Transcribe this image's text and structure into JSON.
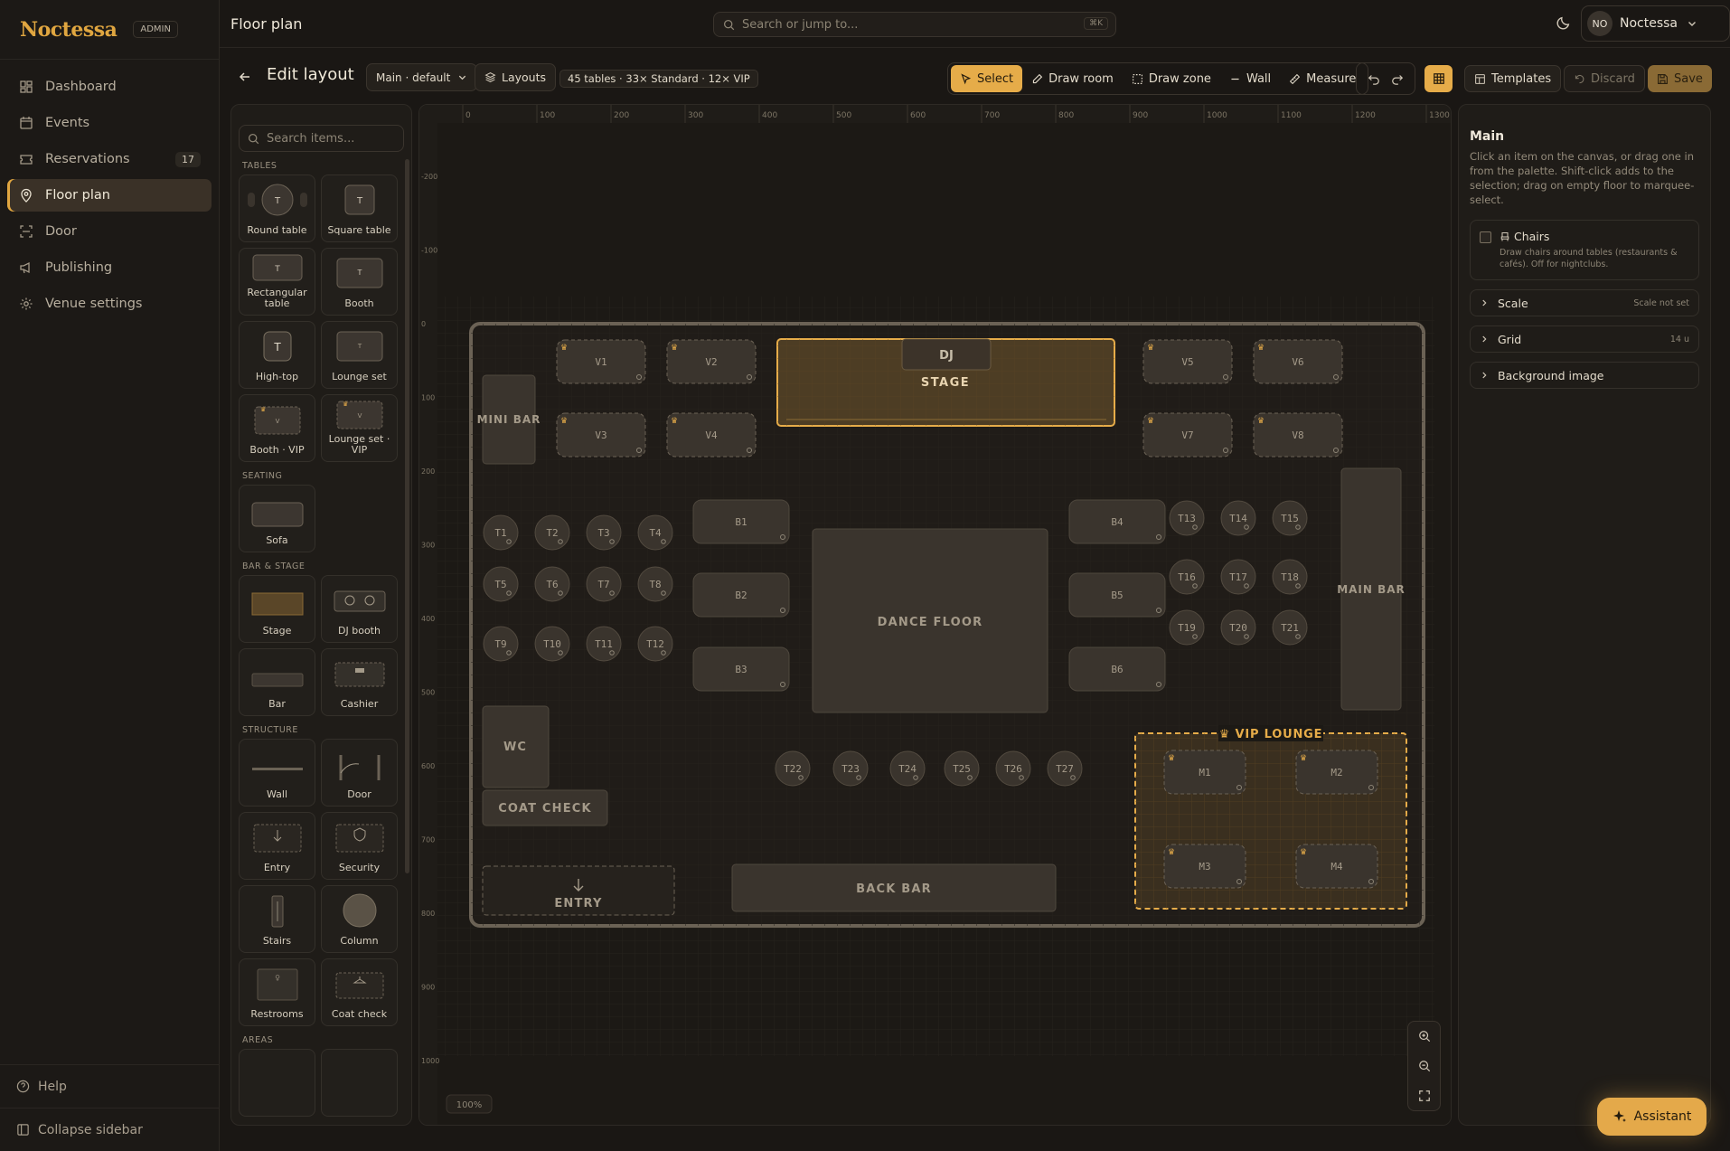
{
  "brand": {
    "name": "Noctessa",
    "badge": "ADMIN"
  },
  "nav": [
    {
      "label": "Dashboard",
      "icon": "dashboard-icon"
    },
    {
      "label": "Events",
      "icon": "calendar-icon"
    },
    {
      "label": "Reservations",
      "icon": "ticket-icon",
      "count": "17"
    },
    {
      "label": "Floor plan",
      "icon": "map-pin-icon",
      "active": true
    },
    {
      "label": "Door",
      "icon": "scan-icon"
    },
    {
      "label": "Publishing",
      "icon": "megaphone-icon"
    },
    {
      "label": "Venue settings",
      "icon": "gear-icon"
    }
  ],
  "footer": {
    "help": "Help",
    "collapse": "Collapse sidebar"
  },
  "topbar": {
    "title": "Floor plan",
    "search_placeholder": "Search or jump to...",
    "search_kbd": "⌘K",
    "user_initials": "NO",
    "user_name": "Noctessa"
  },
  "toolbar": {
    "heading": "Edit layout",
    "layout_select": "Main · default",
    "layouts_btn": "Layouts",
    "stats": "45 tables · 33× Standard · 12× VIP",
    "tools": [
      "Select",
      "Draw room",
      "Draw zone",
      "Wall",
      "Measure"
    ],
    "templates": "Templates",
    "discard": "Discard",
    "save": "Save"
  },
  "palette": {
    "search_placeholder": "Search items...",
    "sections": [
      {
        "label": "TABLES",
        "items": [
          "Round table",
          "Square table",
          "Rectangular table",
          "Booth",
          "High-top",
          "Lounge set",
          "Booth · VIP",
          "Lounge set · VIP"
        ]
      },
      {
        "label": "SEATING",
        "items": [
          "Sofa"
        ]
      },
      {
        "label": "BAR & STAGE",
        "items": [
          "Stage",
          "DJ booth",
          "Bar",
          "Cashier"
        ]
      },
      {
        "label": "STRUCTURE",
        "items": [
          "Wall",
          "Door",
          "Entry",
          "Security",
          "Stairs",
          "Column",
          "Restrooms",
          "Coat check"
        ]
      },
      {
        "label": "AREAS",
        "items": []
      }
    ]
  },
  "canvas": {
    "zoom": "100%",
    "ruler_x": [
      "0",
      "100",
      "200",
      "300",
      "400",
      "500",
      "600",
      "700",
      "800",
      "900",
      "1000",
      "1100",
      "1200",
      "1300"
    ],
    "ruler_y": [
      "-200",
      "-100",
      "0",
      "100",
      "200",
      "300",
      "400",
      "500",
      "600",
      "700",
      "800",
      "900",
      "1000"
    ],
    "zones": {
      "stage": "STAGE",
      "dj": "DJ",
      "mini_bar": "MINI BAR",
      "main_bar": "MAIN BAR",
      "dance_floor": "DANCE FLOOR",
      "wc": "WC",
      "coat_check": "COAT CHECK",
      "entry": "ENTRY",
      "back_bar": "BACK BAR",
      "vip_lounge": "VIP LOUNGE"
    },
    "vip_tables": [
      "V1",
      "V2",
      "V3",
      "V4",
      "V5",
      "V6",
      "V7",
      "V8"
    ],
    "booths": [
      "B1",
      "B2",
      "B3",
      "B4",
      "B5",
      "B6"
    ],
    "round_tables": [
      "T1",
      "T2",
      "T3",
      "T4",
      "T5",
      "T6",
      "T7",
      "T8",
      "T9",
      "T10",
      "T11",
      "T12",
      "T13",
      "T14",
      "T15",
      "T16",
      "T17",
      "T18",
      "T19",
      "T20",
      "T21",
      "T22",
      "T23",
      "T24",
      "T25",
      "T26",
      "T27"
    ],
    "lounge_tables": [
      "M1",
      "M2",
      "M3",
      "M4"
    ]
  },
  "inspector": {
    "title": "Main",
    "description": "Click an item on the canvas, or drag one in from the palette. Shift-click adds to the selection; drag on empty floor to marquee-select.",
    "chairs_label": "Chairs",
    "chairs_desc": "Draw chairs around tables (restaurants & cafés). Off for nightclubs.",
    "rows": [
      {
        "label": "Scale",
        "value": "Scale not set"
      },
      {
        "label": "Grid",
        "value": "14 u"
      },
      {
        "label": "Background image",
        "value": ""
      }
    ]
  },
  "assistant": "Assistant",
  "colors": {
    "accent": "#e6ac49",
    "bg": "#1a1714"
  }
}
